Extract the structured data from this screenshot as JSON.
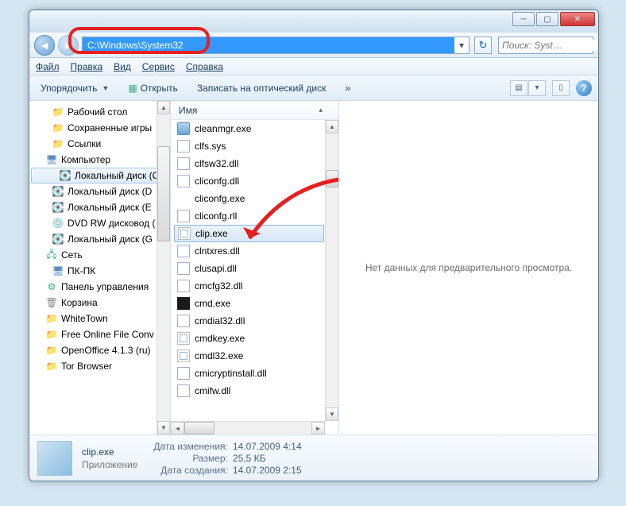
{
  "titlebar": {
    "min": "─",
    "max": "▢",
    "close": "✕"
  },
  "nav": {
    "address": "C:\\Windows\\System32",
    "search_placeholder": "Поиск: Syst…"
  },
  "menu": {
    "file": "Файл",
    "edit": "Правка",
    "view": "Вид",
    "tools": "Сервис",
    "help": "Справка"
  },
  "toolbar": {
    "organize": "Упорядочить",
    "open": "Открыть",
    "burn": "Записать на оптический диск",
    "more": "»"
  },
  "tree": [
    {
      "lvl": 2,
      "icon": "fold",
      "label": "Рабочий стол"
    },
    {
      "lvl": 2,
      "icon": "fold",
      "label": "Сохраненные игры"
    },
    {
      "lvl": 2,
      "icon": "fold",
      "label": "Ссылки"
    },
    {
      "lvl": 1,
      "icon": "comp",
      "label": "Компьютер"
    },
    {
      "lvl": 2,
      "icon": "drv",
      "label": "Локальный диск (C",
      "sel": true
    },
    {
      "lvl": 2,
      "icon": "drv",
      "label": "Локальный диск (D"
    },
    {
      "lvl": 2,
      "icon": "drv",
      "label": "Локальный диск (E"
    },
    {
      "lvl": 2,
      "icon": "dvd",
      "label": "DVD RW дисковод ("
    },
    {
      "lvl": 2,
      "icon": "drv",
      "label": "Локальный диск (G"
    },
    {
      "lvl": 1,
      "icon": "net",
      "label": "Сеть"
    },
    {
      "lvl": 2,
      "icon": "comp",
      "label": "ПК-ПК"
    },
    {
      "lvl": 1,
      "icon": "cp",
      "label": "Панель управления"
    },
    {
      "lvl": 1,
      "icon": "bin",
      "label": "Корзина"
    },
    {
      "lvl": 1,
      "icon": "fold",
      "label": "WhiteTown"
    },
    {
      "lvl": 1,
      "icon": "fold",
      "label": "Free Online File Conv"
    },
    {
      "lvl": 1,
      "icon": "fold",
      "label": "OpenOffice 4.1.3 (ru)"
    },
    {
      "lvl": 1,
      "icon": "fold",
      "label": "Tor Browser"
    }
  ],
  "column_header": "Имя",
  "files": [
    {
      "icon": "ex1",
      "name": "cleanmgr.exe"
    },
    {
      "icon": "ex2",
      "name": "clfs.sys"
    },
    {
      "icon": "ex2",
      "name": "clfsw32.dll"
    },
    {
      "icon": "ex2",
      "name": "cliconfg.dll"
    },
    {
      "icon": "ex5",
      "name": "cliconfg.exe"
    },
    {
      "icon": "ex2",
      "name": "cliconfg.rll"
    },
    {
      "icon": "ex3",
      "name": "clip.exe",
      "sel": true
    },
    {
      "icon": "ex2",
      "name": "clntxres.dll"
    },
    {
      "icon": "ex2",
      "name": "clusapi.dll"
    },
    {
      "icon": "ex2",
      "name": "cmcfg32.dll"
    },
    {
      "icon": "ex4",
      "name": "cmd.exe"
    },
    {
      "icon": "ex2",
      "name": "cmdial32.dll"
    },
    {
      "icon": "ex3",
      "name": "cmdkey.exe"
    },
    {
      "icon": "ex3",
      "name": "cmdl32.exe"
    },
    {
      "icon": "ex2",
      "name": "cmicryptinstall.dll"
    },
    {
      "icon": "ex2",
      "name": "cmifw.dll"
    }
  ],
  "preview_text": "Нет данных для предварительного просмотра.",
  "details": {
    "filename": "clip.exe",
    "filetype": "Приложение",
    "modified_label": "Дата изменения:",
    "modified_value": "14.07.2009 4:14",
    "size_label": "Размер:",
    "size_value": "25,5 КБ",
    "created_label": "Дата создания:",
    "created_value": "14.07.2009 2:15"
  }
}
